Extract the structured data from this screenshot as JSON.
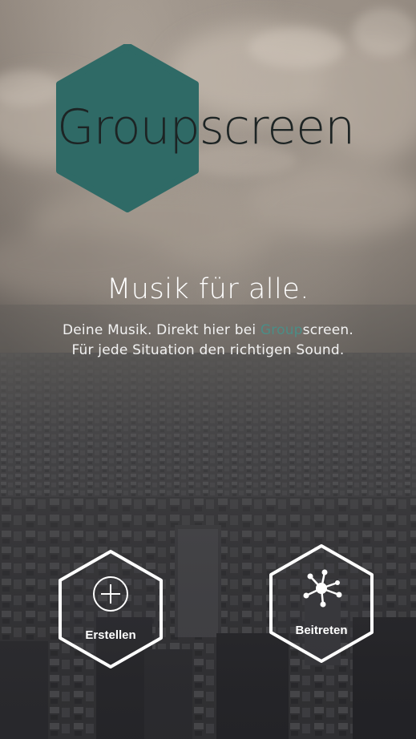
{
  "logo": {
    "part1": "Group",
    "part2": "screen",
    "hex_color": "#2f6a66"
  },
  "headline": "Musik für alle.",
  "subline": {
    "line1_prefix": "Deine Musik. Direkt hier bei ",
    "line1_brand_a": "Group",
    "line1_brand_b": "screen.",
    "line2": "Für jede Situation den richtigen Sound."
  },
  "buttons": {
    "create": {
      "label": "Erstellen",
      "icon": "plus-circle-icon"
    },
    "join": {
      "label": "Beitreten",
      "icon": "network-icon"
    }
  },
  "colors": {
    "accent": "#4b8d86",
    "brand_hex": "#2f6a66"
  }
}
